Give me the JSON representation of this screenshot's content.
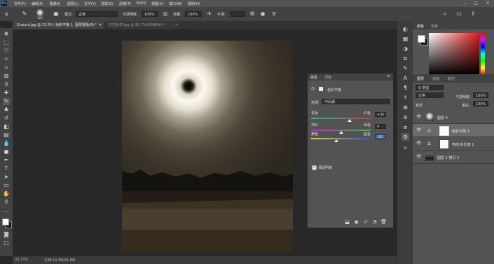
{
  "app": {
    "logo": "Ps"
  },
  "menu": [
    "文件(F)",
    "编辑(E)",
    "图像(I)",
    "图层(L)",
    "文字(Y)",
    "选择(S)",
    "滤镜(T)",
    "3D(D)",
    "视图(V)",
    "窗口(W)",
    "帮助(H)"
  ],
  "options": {
    "brush_size": "100",
    "mode_label": "模式:",
    "mode_value": "正常",
    "opacity_label": "不透明度:",
    "opacity_value": "100%",
    "flow_label": "流量:",
    "flow_value": "100%",
    "smooth_label": "平滑:"
  },
  "tabs": [
    {
      "label": "Ground.jpg @ 33.3% (色彩平衡 1, 图层蒙版/8) *",
      "close": "×"
    },
    {
      "label": "天空素材.jpg @ 30.7%(RGB/8#) *",
      "close": "×"
    }
  ],
  "status": {
    "zoom": "33.33%",
    "doc": "文档:19.3M/41.8M"
  },
  "properties": {
    "tab_properties": "属性",
    "tab_adjust": "调整",
    "adj_title": "色彩平衡",
    "tone_label": "色调:",
    "tone_value": "中间调",
    "sliders": [
      {
        "left": "青色",
        "right": "红色",
        "value": "+30",
        "pos": 0.65,
        "colors": [
          "#00c8c8",
          "#e03030"
        ]
      },
      {
        "left": "洋红",
        "right": "绿色",
        "value": "0",
        "pos": 0.5,
        "colors": [
          "#d020d0",
          "#30c030"
        ]
      },
      {
        "left": "黄色",
        "right": "蓝色",
        "value": "-16",
        "pos": 0.42,
        "colors": [
          "#e0d020",
          "#3050e0"
        ]
      }
    ],
    "preserve_label": "保留明度",
    "preserve_checked": true
  },
  "right_panel": {
    "color_tabs": [
      "颜色",
      "色板"
    ],
    "layers_tabs": [
      "图层",
      "通道",
      "路径"
    ],
    "kind_label": "Q 类型",
    "blend_mode": "正常",
    "opacity_label": "不透明度:",
    "opacity_value": "100%",
    "lock_label": "锁定:",
    "fill_label": "填充:",
    "fill_value": "100%",
    "layers": [
      {
        "name": "图层 0",
        "selected": false,
        "type": "image"
      },
      {
        "name": "色彩平衡 1",
        "selected": true,
        "type": "adjust"
      },
      {
        "name": "亮度/对比度 1",
        "selected": false,
        "type": "adjust"
      },
      {
        "name": "图层 1 拷贝 2",
        "selected": false,
        "type": "image2"
      }
    ]
  },
  "colors": {
    "accent": "#31a8ff",
    "foreground": "#ffffff",
    "background": "#1a1a1a"
  }
}
